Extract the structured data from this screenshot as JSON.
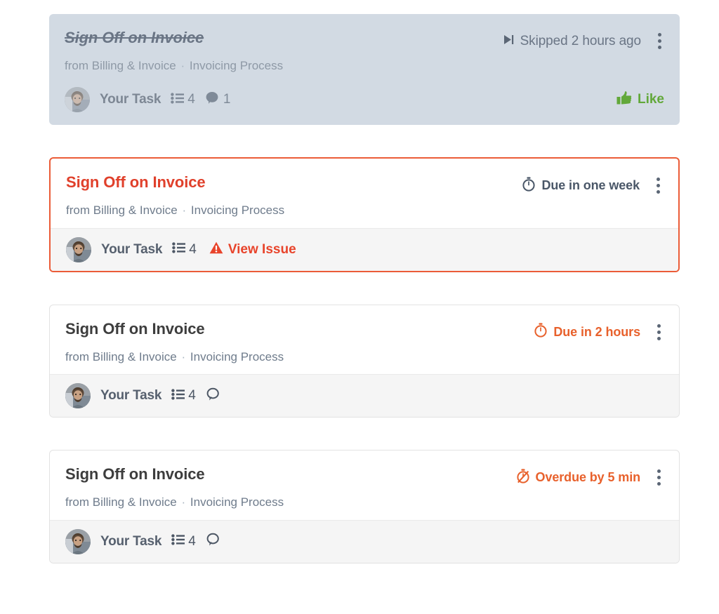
{
  "cards": [
    {
      "title": "Sign Off on Invoice",
      "source_prefix": "from",
      "source_project": "Billing & Invoice",
      "source_sep": "·",
      "source_process": "Invoicing Process",
      "status_text": "Skipped 2 hours ago",
      "status_icon": "skip-forward-icon",
      "state": "skipped",
      "assignee": "Your Task",
      "checklist_count": "4",
      "comment_count": "1",
      "action_label": "Like",
      "action_icon": "thumbs-up-icon",
      "menu_icon": "kebab-menu-icon",
      "colors": {
        "background": "#d2dae3",
        "title": "#6a7585",
        "status": "#6a7585",
        "action": "#62a83a"
      }
    },
    {
      "title": "Sign Off on Invoice",
      "source_prefix": "from",
      "source_project": "Billing & Invoice",
      "source_sep": "·",
      "source_process": "Invoicing Process",
      "status_text": "Due in one week",
      "status_icon": "stopwatch-icon",
      "state": "issue",
      "assignee": "Your Task",
      "checklist_count": "4",
      "issue_label": "View Issue",
      "issue_icon": "warning-triangle-icon",
      "menu_icon": "kebab-menu-icon",
      "colors": {
        "border": "#eb5c38",
        "title": "#e0402b",
        "status": "#4a5768",
        "issue": "#e8442b"
      }
    },
    {
      "title": "Sign Off on Invoice",
      "source_prefix": "from",
      "source_project": "Billing & Invoice",
      "source_sep": "·",
      "source_process": "Invoicing Process",
      "status_text": "Due in 2 hours",
      "status_icon": "stopwatch-icon",
      "state": "due-soon",
      "assignee": "Your Task",
      "checklist_count": "4",
      "comment_count": "",
      "menu_icon": "kebab-menu-icon",
      "colors": {
        "border": "#e2e2e2",
        "title": "#3d3d3d",
        "status": "#e8612c"
      }
    },
    {
      "title": "Sign Off on Invoice",
      "source_prefix": "from",
      "source_project": "Billing & Invoice",
      "source_sep": "·",
      "source_process": "Invoicing Process",
      "status_text": "Overdue by 5 min",
      "status_icon": "stopwatch-off-icon",
      "state": "overdue",
      "assignee": "Your Task",
      "checklist_count": "4",
      "comment_count": "",
      "menu_icon": "kebab-menu-icon",
      "colors": {
        "border": "#e2e2e2",
        "title": "#3d3d3d",
        "status": "#e8612c"
      }
    }
  ]
}
